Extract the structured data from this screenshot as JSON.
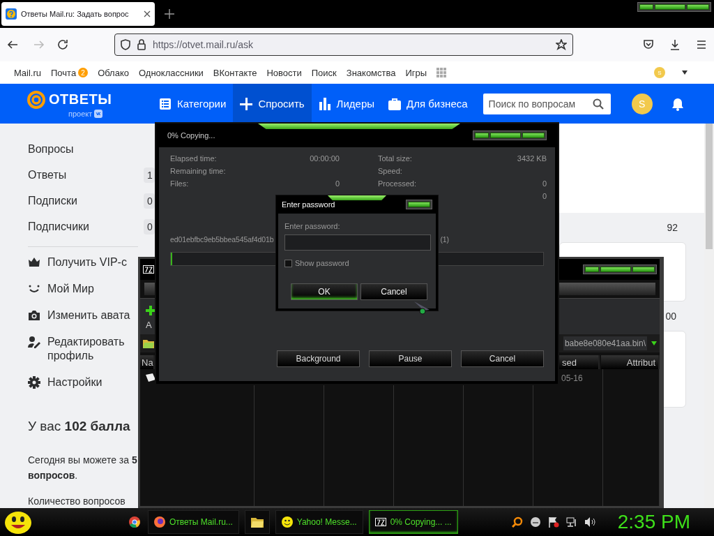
{
  "browser": {
    "tab": {
      "title": "Ответы Mail.ru: Задать вопрос",
      "selected": true
    },
    "url": "https://otvet.mail.ru/ask",
    "portal_links": [
      {
        "label": "Mail.ru"
      },
      {
        "label": "Почта",
        "badge": "2"
      },
      {
        "label": "Облако"
      },
      {
        "label": "Одноклассники"
      },
      {
        "label": "ВКонтакте"
      },
      {
        "label": "Новости"
      },
      {
        "label": "Поиск"
      },
      {
        "label": "Знакомства"
      },
      {
        "label": "Игры"
      }
    ],
    "portal_avatar": "S"
  },
  "header": {
    "logo": "ОТВЕТЫ",
    "logo_sub": "проект",
    "nav": [
      {
        "label": "Категории",
        "selected": false
      },
      {
        "label": "Спросить",
        "selected": true
      },
      {
        "label": "Лидеры",
        "selected": false
      },
      {
        "label": "Для бизнеса",
        "selected": false
      }
    ],
    "search": {
      "placeholder": "Поиск по вопросам"
    },
    "avatar": "S"
  },
  "sidebar": {
    "stats": [
      {
        "label": "Вопросы"
      },
      {
        "label": "Ответы",
        "count": "1"
      },
      {
        "label": "Подписки",
        "count": "0"
      },
      {
        "label": "Подписчики",
        "count": "0"
      }
    ],
    "actions": [
      {
        "label": "Получить VIP-с"
      },
      {
        "label": "Мой Мир"
      },
      {
        "label": "Изменить авата"
      },
      {
        "label": "Редактировать профиль"
      },
      {
        "label": "Настройки"
      }
    ],
    "points": "У вас **102 балла**",
    "today": "Сегодня вы можете за **5 вопросов**.",
    "quota": "Количество вопросов"
  },
  "right_column": {
    "values": [
      "92",
      "00"
    ]
  },
  "zip_window": {
    "toolbar": [
      "A"
    ],
    "path": "babe8e080e41aa.bin\\",
    "columns": [
      "Na",
      "sed",
      "Attribut"
    ],
    "row": {
      "date": "05-16"
    }
  },
  "copy_dialog": {
    "title": "0% Copying...",
    "left_stats": [
      {
        "label": "Elapsed time:",
        "value": "00:00:00"
      },
      {
        "label": "Remaining time:"
      },
      {
        "label": "Files:",
        "value": "0"
      }
    ],
    "right_stats": [
      {
        "label": "Total size:",
        "value": "3432 KB"
      },
      {
        "label": "Speed:"
      },
      {
        "label": "Processed:",
        "value": "0"
      },
      {
        "value": "0"
      }
    ],
    "file": "ed01ebfbc9eb5bbea545af4d01b",
    "file_count": "(1)",
    "progress": {
      "level": 0
    },
    "buttons": [
      "Background",
      "Pause",
      "Cancel"
    ]
  },
  "password_dialog": {
    "title": "Enter password",
    "label": "Enter password:",
    "show_password": {
      "label": "Show password",
      "checked": false
    },
    "buttons": [
      {
        "label": "OK",
        "focused": true
      },
      {
        "label": "Cancel",
        "focused": false
      }
    ]
  },
  "taskbar": {
    "items": [
      {
        "kind": "pinned",
        "selected": false
      },
      {
        "kind": "browser",
        "label": "Ответы Mail.ru...",
        "selected": false
      },
      {
        "kind": "folder",
        "selected": false
      },
      {
        "kind": "messenger",
        "label": "Yahoo! Messe...",
        "selected": false
      },
      {
        "kind": "archiver",
        "label": "0% Copying... ...",
        "selected": true
      }
    ],
    "clock": "2:35 PM"
  }
}
